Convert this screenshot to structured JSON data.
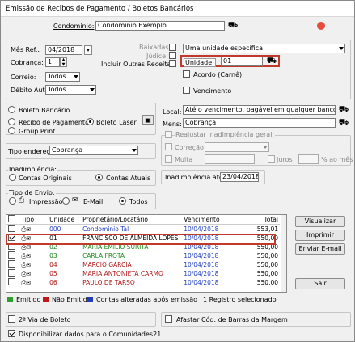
{
  "window": {
    "title": "Emissão de Recibos de Pagamento / Boletos Bancários"
  },
  "header": {
    "condominio_label": "Condomínio:",
    "condominio_value": "Condominio Exemplo"
  },
  "filters": {
    "mes_ref_label": "Mês Ref.:",
    "mes_ref_value": "04/2018",
    "cobranca_label": "Cobrança:",
    "cobranca_value": "1",
    "correio_label": "Correio:",
    "correio_value": "Todos",
    "debito_label": "Débito Aut.:",
    "debito_value": "Todos",
    "baixadas_label": "Baixadas",
    "judice_label": "Júdice",
    "incluir_label": "Incluir Outras Receitas",
    "unidade_select": "Uma unidade específica",
    "unidade_label": "Unidade:",
    "unidade_value": "01",
    "acordo_label": "Acordo (Carnê)",
    "vencimento_label": "Vencimento"
  },
  "print": {
    "boleto_bancario": "Boleto Bancário",
    "recibo_pagamento": "Recibo de Pagamento",
    "boleto_laser": "Boleto Laser",
    "group_print": "Group Print",
    "local_label": "Local:",
    "local_value": "Até o vencimento, pagável em qualquer banco.",
    "mens_label": "Mens:",
    "mens_value": "Cobrança"
  },
  "reajustar": {
    "title": "Reajustar inadimplência geral:",
    "correcao": "Correção",
    "multa": "Multa",
    "juros": "Juros",
    "juros_suffix": "% ao mês",
    "multa_value": "",
    "juros_value": ""
  },
  "endereco": {
    "label": "Tipo endereço:",
    "value": "Cobrança"
  },
  "inadimplencia": {
    "title": "Inadimplência:",
    "contas_originais": "Contas Originais",
    "contas_atuais": "Contas Atuais",
    "ate_label": "Inadimplência até:",
    "ate_value": "23/04/2018"
  },
  "envio": {
    "title": "Tipo de Envio:",
    "impressao": "Impressão",
    "email": "E-Mail",
    "todos": "Todos"
  },
  "table": {
    "headers": [
      "Tipo",
      "Unidade",
      "Proprietário/Locatário",
      "Vencimento",
      "Total"
    ],
    "rows": [
      {
        "unit": "000",
        "name": "Condomínio Tal",
        "venc": "10/04/2018",
        "total": "553,01",
        "color": "#1f3fbf",
        "checked": false
      },
      {
        "unit": "01",
        "name": "FRANCISCO DE ALMEIDA LOPES",
        "venc": "10/04/2018",
        "total": "550,00",
        "color": "#000000",
        "checked": true
      },
      {
        "unit": "02",
        "name": "MARIA EMILIO SURITA",
        "venc": "10/04/2018",
        "total": "550,00",
        "color": "#1e8a1e",
        "checked": false
      },
      {
        "unit": "03",
        "name": "CARLA FROTA",
        "venc": "10/04/2018",
        "total": "550,00",
        "color": "#1e8a1e",
        "checked": false
      },
      {
        "unit": "04",
        "name": "MARCIO GARCIA",
        "venc": "10/04/2018",
        "total": "550,00",
        "color": "#b01515",
        "checked": false
      },
      {
        "unit": "05",
        "name": "MARIA ANTONIETA CARMO",
        "venc": "10/04/2018",
        "total": "550,00",
        "color": "#b01515",
        "checked": false
      },
      {
        "unit": "06",
        "name": "PAULO DE TARSO",
        "venc": "10/04/2018",
        "total": "550,00",
        "color": "#b01515",
        "checked": false
      }
    ]
  },
  "buttons": {
    "visualizar": "Visualizar",
    "imprimir": "Imprimir",
    "enviar": "Enviar E-mail",
    "sair": "Sair"
  },
  "legend": {
    "emitido": "Emitido",
    "nao_emitido": "Não Emitido",
    "alteradas": "Contas alteradas após emissão",
    "selecionado": "1 Registro selecionado",
    "emitido_color": "#2e9e2e",
    "nao_emitido_color": "#c01818",
    "alteradas_color": "#1f3fbf"
  },
  "footer": {
    "segunda_via": "2ª Via de Boleto",
    "afastar": "Afastar Cód. de Barras da Margem",
    "disponibilizar": "Disponibilizar dados para o Comunidades21"
  }
}
